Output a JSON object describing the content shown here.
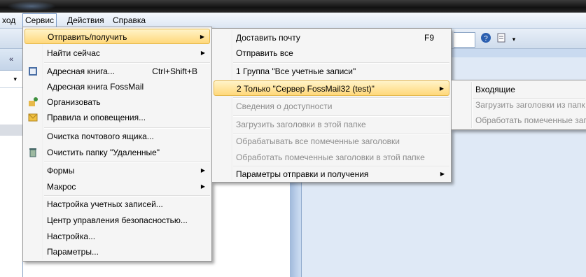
{
  "menubar": {
    "items": [
      {
        "label": "ход"
      },
      {
        "label": "Сервис"
      },
      {
        "label": "Действия"
      },
      {
        "label": "Справка"
      }
    ]
  },
  "left_pane": {
    "collapse_glyph": "«",
    "dropdown_glyph": "▾"
  },
  "service_menu": {
    "items": [
      {
        "label": "Отправить/получить",
        "submenu": true
      },
      {
        "label": "Найти сейчас",
        "submenu": true
      },
      {
        "label": "Адресная книга...",
        "shortcut": "Ctrl+Shift+B",
        "icon": "address-book-icon"
      },
      {
        "label": "Адресная книга FossMail"
      },
      {
        "label": "Организовать",
        "icon": "organize-icon"
      },
      {
        "label": "Правила и оповещения...",
        "icon": "rules-icon"
      },
      {
        "label": "Очистка почтового ящика..."
      },
      {
        "label": "Очистить папку \"Удаленные\"",
        "icon": "recycle-bin-icon"
      },
      {
        "label": "Формы",
        "submenu": true
      },
      {
        "label": "Макрос",
        "submenu": true
      },
      {
        "label": "Настройка учетных записей..."
      },
      {
        "label": "Центр управления безопасностью..."
      },
      {
        "label": "Настройка..."
      },
      {
        "label": "Параметры..."
      }
    ]
  },
  "send_receive_menu": {
    "items": [
      {
        "label": "Доставить почту",
        "shortcut": "F9"
      },
      {
        "label": "Отправить все"
      },
      {
        "label": "1 Группа \"Все учетные записи\""
      },
      {
        "label": "2 Только \"Сервер FossMail32 (test)\"",
        "submenu": true
      },
      {
        "label": "Сведения о доступности",
        "disabled": true
      },
      {
        "label": "Загрузить заголовки в этой папке",
        "disabled": true
      },
      {
        "label": "Обрабатывать все помеченные заголовки",
        "disabled": true
      },
      {
        "label": "Обработать помеченные заголовки в этой папке",
        "disabled": true
      },
      {
        "label": "Параметры отправки и получения",
        "submenu": true
      }
    ]
  },
  "server_menu": {
    "items": [
      {
        "label": "Входящие"
      },
      {
        "label": "Загрузить заголовки из папк",
        "disabled": true
      },
      {
        "label": "Обработать помеченные заг",
        "disabled": true
      }
    ]
  },
  "toolbar": {
    "help_icon": "help-icon",
    "options_icon": "options-icon"
  }
}
